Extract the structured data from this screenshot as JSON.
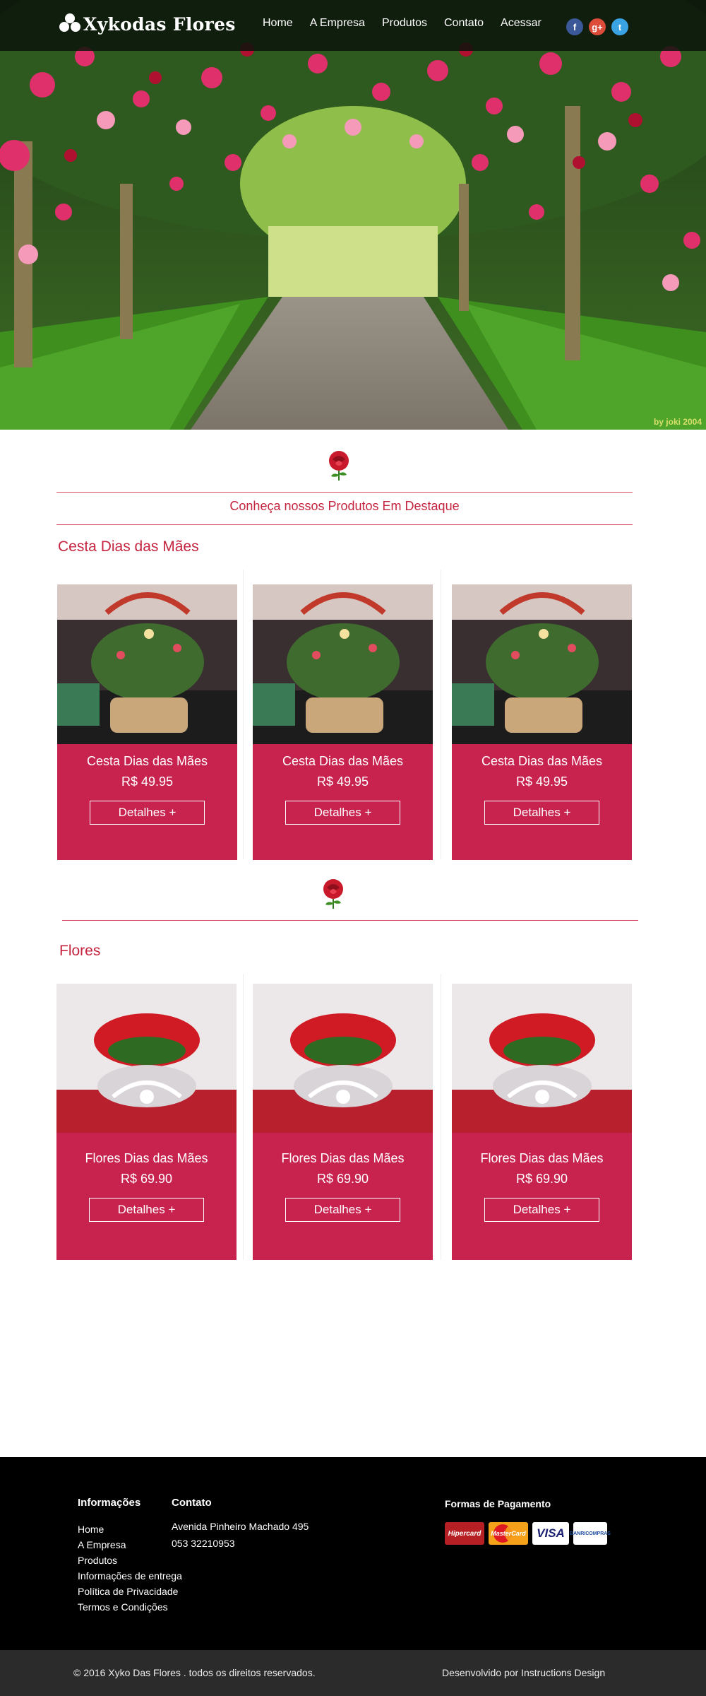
{
  "header": {
    "logo_text": "Xykodas Flores",
    "nav": [
      {
        "label": "Home"
      },
      {
        "label": "A Empresa"
      },
      {
        "label": "Produtos"
      },
      {
        "label": "Contato"
      },
      {
        "label": "Acessar"
      }
    ],
    "social": [
      {
        "icon": "facebook-icon",
        "glyph": "f",
        "color": "#3b5998"
      },
      {
        "icon": "google-plus-icon",
        "glyph": "g+",
        "color": "#dd4b39"
      },
      {
        "icon": "twitter-icon",
        "glyph": "t",
        "color": "#3aa3e3"
      }
    ]
  },
  "hero": {
    "credit": "by joki 2004"
  },
  "featured": {
    "title": "Conheça nossos Produtos Em Destaque"
  },
  "sections": [
    {
      "title": "Cesta Dias das Mães",
      "products": [
        {
          "name": "Cesta Dias das Mães",
          "price": "R$ 49.95",
          "button": "Detalhes +"
        },
        {
          "name": "Cesta Dias das Mães",
          "price": "R$ 49.95",
          "button": "Detalhes +"
        },
        {
          "name": "Cesta Dias das Mães",
          "price": "R$ 49.95",
          "button": "Detalhes +"
        }
      ]
    },
    {
      "title": "Flores",
      "products": [
        {
          "name": "Flores Dias das Mães",
          "price": "R$ 69.90",
          "button": "Detalhes +"
        },
        {
          "name": "Flores Dias das Mães",
          "price": "R$ 69.90",
          "button": "Detalhes +"
        },
        {
          "name": "Flores Dias das Mães",
          "price": "R$ 69.90",
          "button": "Detalhes +"
        }
      ]
    }
  ],
  "footer": {
    "info_heading": "Informações",
    "info_links": [
      "Home",
      "A Empresa",
      "Produtos",
      "Informações de entrega",
      "Política de Privacidade",
      "Termos e Condições"
    ],
    "contact_heading": "Contato",
    "contact_lines": [
      "Avenida Pinheiro Machado 495",
      "053 32210953"
    ],
    "payment_heading": "Formas de Pagamento",
    "payments": [
      "Hipercard",
      "MasterCard",
      "VISA",
      "BANRICOMPRAS"
    ],
    "copyright": "© 2016 Xyko Das Flores . todos os direitos reservados.",
    "developer": "Desenvolvido por Instructions Design"
  },
  "colors": {
    "accent": "#c8224f",
    "title_red": "#c5243f",
    "footer_bg": "#000000",
    "bottom_bg": "#2b2b2b"
  }
}
